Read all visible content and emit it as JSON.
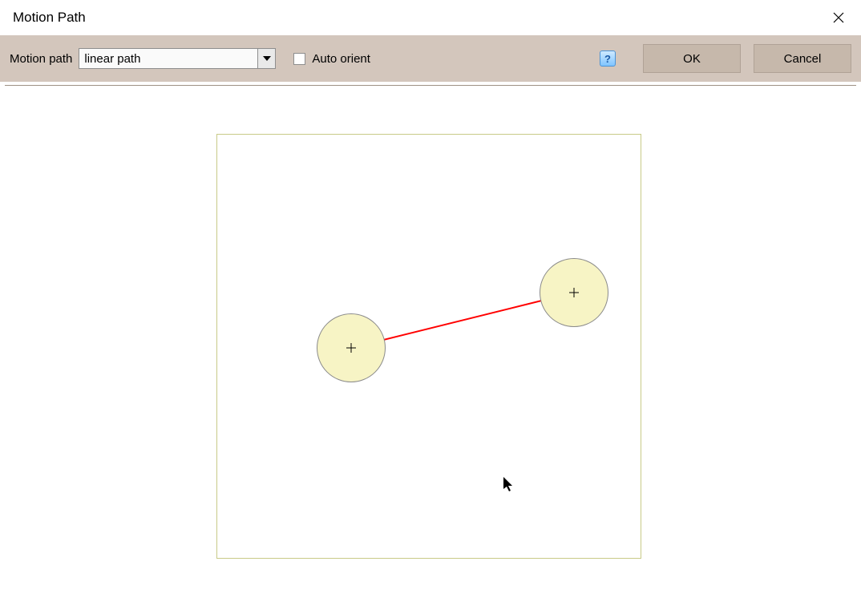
{
  "dialog": {
    "title": "Motion Path"
  },
  "toolbar": {
    "motion_path_label": "Motion path",
    "dropdown_value": "linear path",
    "auto_orient_label": "Auto orient",
    "auto_orient_checked": false,
    "help_symbol": "?",
    "ok_label": "OK",
    "cancel_label": "Cancel"
  }
}
